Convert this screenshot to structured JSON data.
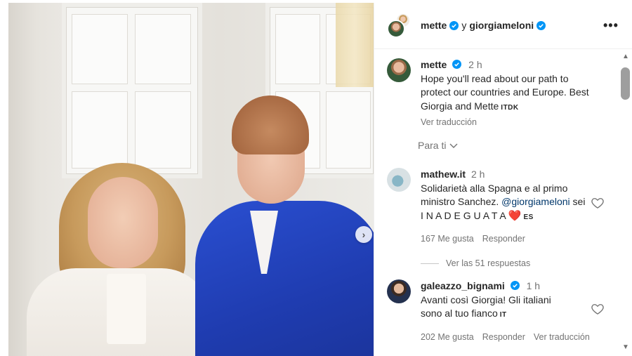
{
  "header": {
    "user1": "mette",
    "separator": "y",
    "user2": "giorgiameloni",
    "more_label": "•••"
  },
  "colors": {
    "verified": "#0095f6",
    "link": "#00376b",
    "heart": "#e8344e",
    "muted": "#737373"
  },
  "carousel": {
    "next_icon": "›"
  },
  "caption": {
    "user": "mette",
    "time": "2 h",
    "text": "Hope you'll read about our path to protect our countries and Europe. Best Giorgia and Mette",
    "lang": "ITDK",
    "translate_label": "Ver traducción"
  },
  "sort": {
    "label": "Para ti",
    "icon": "chevron-down-icon"
  },
  "comments": [
    {
      "user": "mathew.it",
      "time": "2 h",
      "text_before": "Solidarietà alla Spagna e al primo ministro Sanchez.",
      "mention": "@giorgiameloni",
      "text_after": "sei I N A D E G U A T A",
      "emoji": "❤️",
      "lang": "ES",
      "likes": "167 Me gusta",
      "reply_label": "Responder"
    },
    {
      "user": "galeazzo_bignami",
      "time": "1 h",
      "text": "Avanti così Giorgia! Gli italiani sono al tuo fianco",
      "lang": "IT",
      "likes": "202 Me gusta",
      "reply_label": "Responder",
      "translate_label": "Ver traducción"
    }
  ],
  "view_replies": "Ver las 51 respuestas"
}
